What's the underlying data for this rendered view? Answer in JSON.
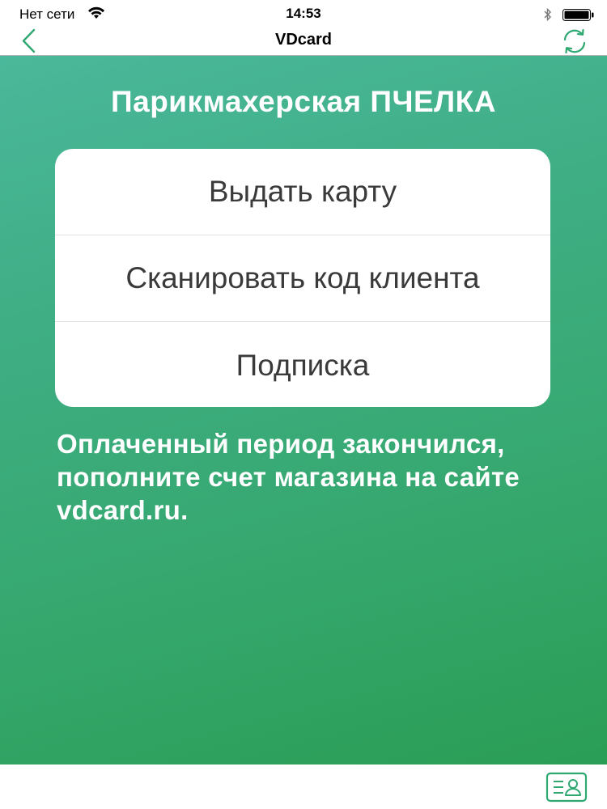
{
  "status_bar": {
    "carrier": "Нет сети",
    "time": "14:53"
  },
  "nav": {
    "title": "VDcard",
    "back_icon": "chevron-left-icon",
    "refresh_icon": "refresh-icon"
  },
  "main": {
    "shop_title": "Парикмахерская ПЧЕЛКА",
    "menu": [
      {
        "label": "Выдать карту"
      },
      {
        "label": "Сканировать код клиента"
      },
      {
        "label": "Подписка"
      }
    ],
    "notice": "Оплаченный период закончился, пополните счет магазина на сайте vdcard.ru."
  },
  "bottom_bar": {
    "card_icon": "member-card-icon"
  },
  "colors": {
    "accent": "#2fa872",
    "gradient_start": "#4ab89a",
    "gradient_end": "#2a9d55"
  }
}
